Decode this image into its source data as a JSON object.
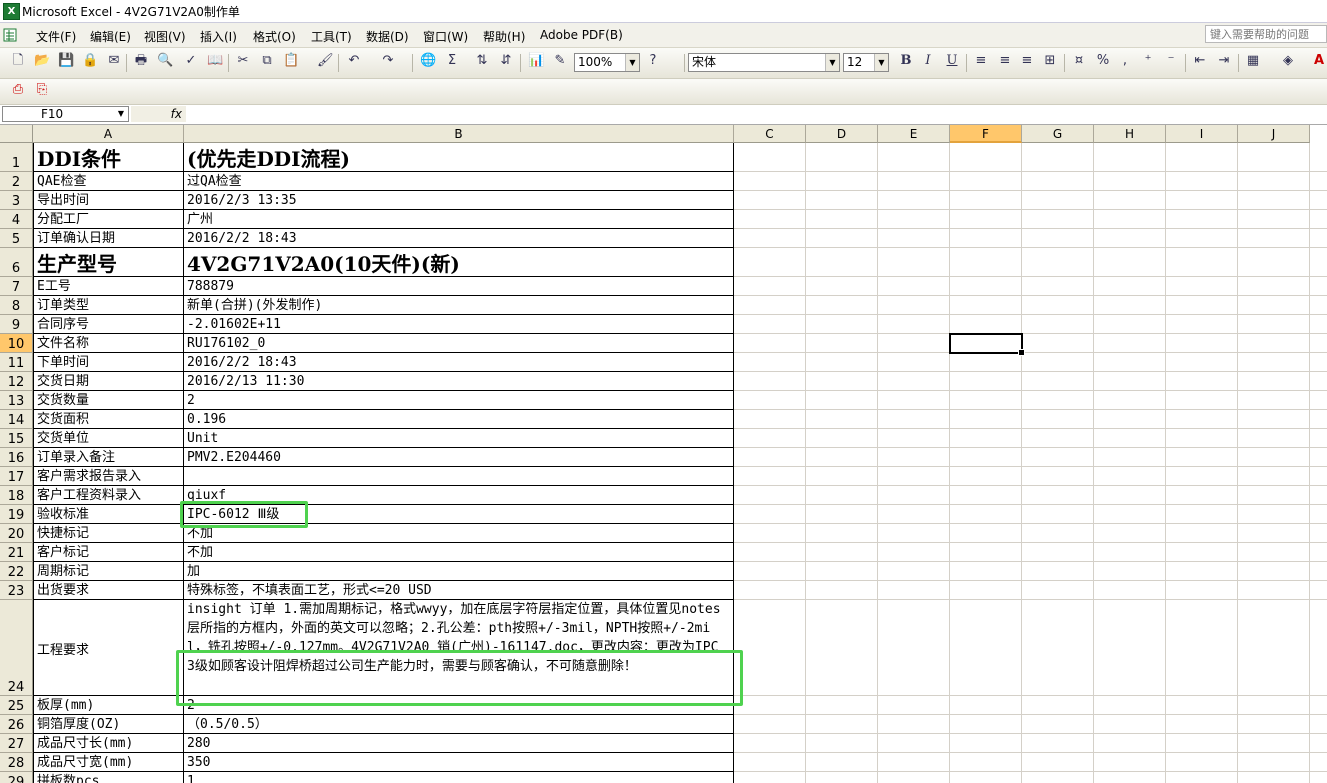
{
  "app": {
    "title": "Microsoft Excel - 4V2G71V2A0制作单"
  },
  "menu": {
    "items": [
      "文件(F)",
      "编辑(E)",
      "视图(V)",
      "插入(I)",
      "格式(O)",
      "工具(T)",
      "数据(D)",
      "窗口(W)",
      "帮助(H)",
      "Adobe PDF(B)"
    ],
    "help_placeholder": "键入需要帮助的问题"
  },
  "toolbar": {
    "zoom": "100%",
    "font_name": "宋体",
    "font_size": "12",
    "bold": "B",
    "italic": "I",
    "underline": "U",
    "percent": "%"
  },
  "formula_bar": {
    "name_box": "F10",
    "fx_label": "fx",
    "content": ""
  },
  "columns": [
    "A",
    "B",
    "C",
    "D",
    "E",
    "F",
    "G",
    "H",
    "I",
    "J"
  ],
  "selected_cell": "F10",
  "rows": [
    {
      "n": "1",
      "a": "DDI条件",
      "b": "(优先走DDI流程)"
    },
    {
      "n": "2",
      "a": "QAE检查",
      "b": "过QA检查"
    },
    {
      "n": "3",
      "a": "导出时间",
      "b": "2016/2/3 13:35"
    },
    {
      "n": "4",
      "a": "分配工厂",
      "b": "广州"
    },
    {
      "n": "5",
      "a": "订单确认日期",
      "b": "2016/2/2 18:43"
    },
    {
      "n": "6",
      "a": "生产型号",
      "b": "4V2G71V2A0(10天件)(新)"
    },
    {
      "n": "7",
      "a": "E工号",
      "b": "788879"
    },
    {
      "n": "8",
      "a": "订单类型",
      "b": "新单(合拼)(外发制作)"
    },
    {
      "n": "9",
      "a": "合同序号",
      "b": "-2.01602E+11"
    },
    {
      "n": "10",
      "a": "文件名称",
      "b": "RU176102_0"
    },
    {
      "n": "11",
      "a": "下单时间",
      "b": "2016/2/2 18:43"
    },
    {
      "n": "12",
      "a": "交货日期",
      "b": "2016/2/13 11:30"
    },
    {
      "n": "13",
      "a": "交货数量",
      "b": "2"
    },
    {
      "n": "14",
      "a": "交货面积",
      "b": "0.196"
    },
    {
      "n": "15",
      "a": "交货单位",
      "b": "Unit"
    },
    {
      "n": "16",
      "a": "订单录入备注",
      "b": "PMV2.E204460"
    },
    {
      "n": "17",
      "a": "客户需求报告录入",
      "b": ""
    },
    {
      "n": "18",
      "a": "客户工程资料录入",
      "b": "qiuxf"
    },
    {
      "n": "19",
      "a": "验收标准",
      "b": "IPC-6012 Ⅲ级"
    },
    {
      "n": "20",
      "a": "快捷标记",
      "b": "不加"
    },
    {
      "n": "21",
      "a": "客户标记",
      "b": "不加"
    },
    {
      "n": "22",
      "a": "周期标记",
      "b": "加"
    },
    {
      "n": "23",
      "a": "出货要求",
      "b": "特殊标签，不填表面工艺，形式<=20 USD"
    },
    {
      "n": "24",
      "a": "工程要求",
      "b": "insight 订单 1.需加周期标记，格式wwyy，加在底层字符层指定位置，具体位置见notes层所指的方框内，外面的英文可以忽略；2.孔公差：pth按照+/-3mil，NPTH按照+/-2mil，铣孔按照+/-0.127mm。4V2G71V2A0 销(广州)-161147.doc，更改内容：更改为IPC 3级如顾客设计阻焊桥超过公司生产能力时，需要与顾客确认，不可随意删除！"
    },
    {
      "n": "25",
      "a": "板厚(mm)",
      "b": "2"
    },
    {
      "n": "26",
      "a": "铜箔厚度(OZ)",
      "b": "（0.5/0.5）"
    },
    {
      "n": "27",
      "a": "成品尺寸长(mm)",
      "b": "280"
    },
    {
      "n": "28",
      "a": "成品尺寸宽(mm)",
      "b": "350"
    },
    {
      "n": "29",
      "a": "拼板数pcs",
      "b": "1"
    }
  ]
}
